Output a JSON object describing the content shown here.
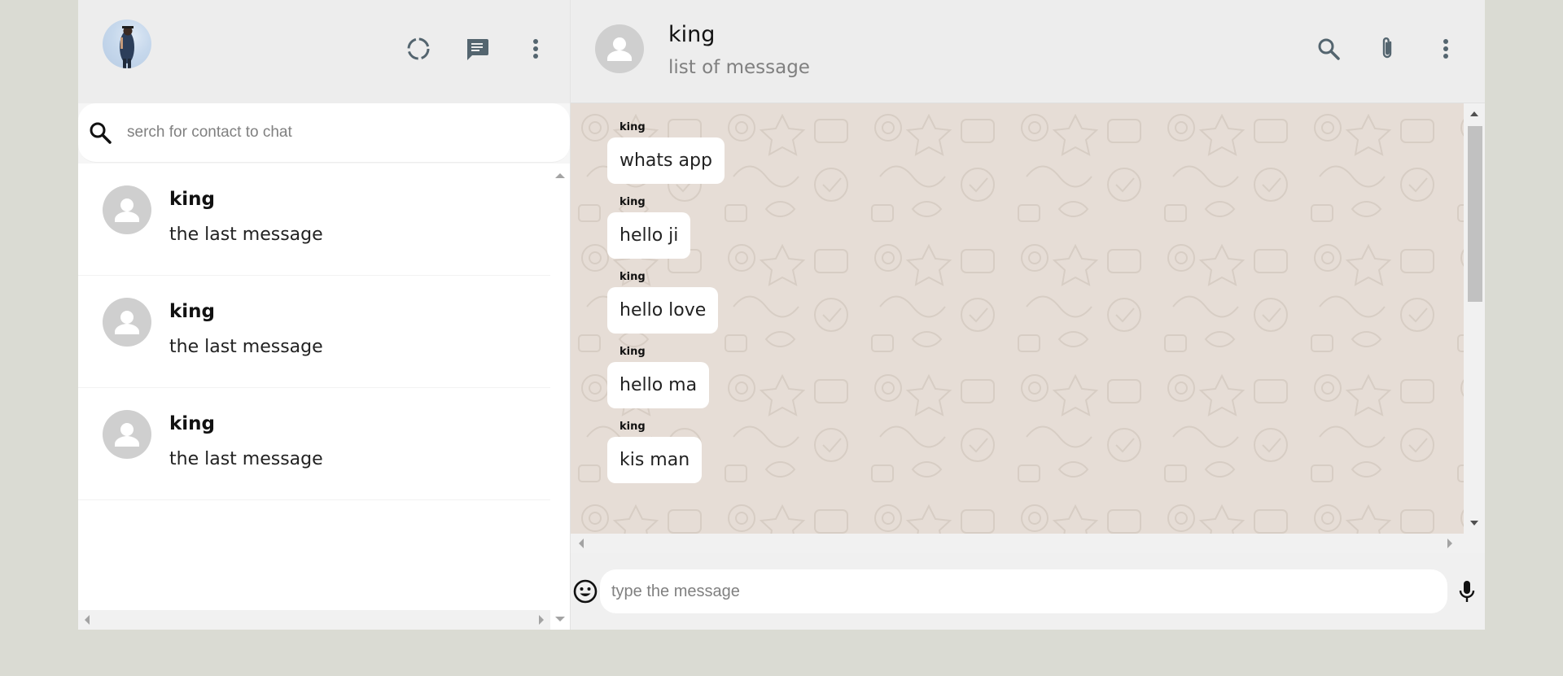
{
  "sidebar": {
    "search": {
      "placeholder": "serch for contact to chat"
    },
    "chats": [
      {
        "name": "king",
        "last_message": "the last message"
      },
      {
        "name": "king",
        "last_message": "the last message"
      },
      {
        "name": "king",
        "last_message": "the last message"
      }
    ],
    "header_icons": [
      "status-icon",
      "new-chat-icon",
      "menu-icon"
    ]
  },
  "chat": {
    "header": {
      "title": "king",
      "subtitle": "list of message"
    },
    "header_icons": [
      "search-icon",
      "attach-icon",
      "menu-icon"
    ],
    "messages": [
      {
        "sender": "king",
        "text": "whats app"
      },
      {
        "sender": "king",
        "text": "hello ji"
      },
      {
        "sender": "king",
        "text": "hello love"
      },
      {
        "sender": "king",
        "text": "hello ma"
      },
      {
        "sender": "king",
        "text": "kis man"
      }
    ],
    "composer": {
      "placeholder": "type the message"
    }
  },
  "colors": {
    "page_bg": "#dadbd3",
    "header_bg": "#ededed",
    "chat_bg": "#e6ddd6",
    "bubble_bg": "#ffffff",
    "icon_color": "#54656f"
  }
}
